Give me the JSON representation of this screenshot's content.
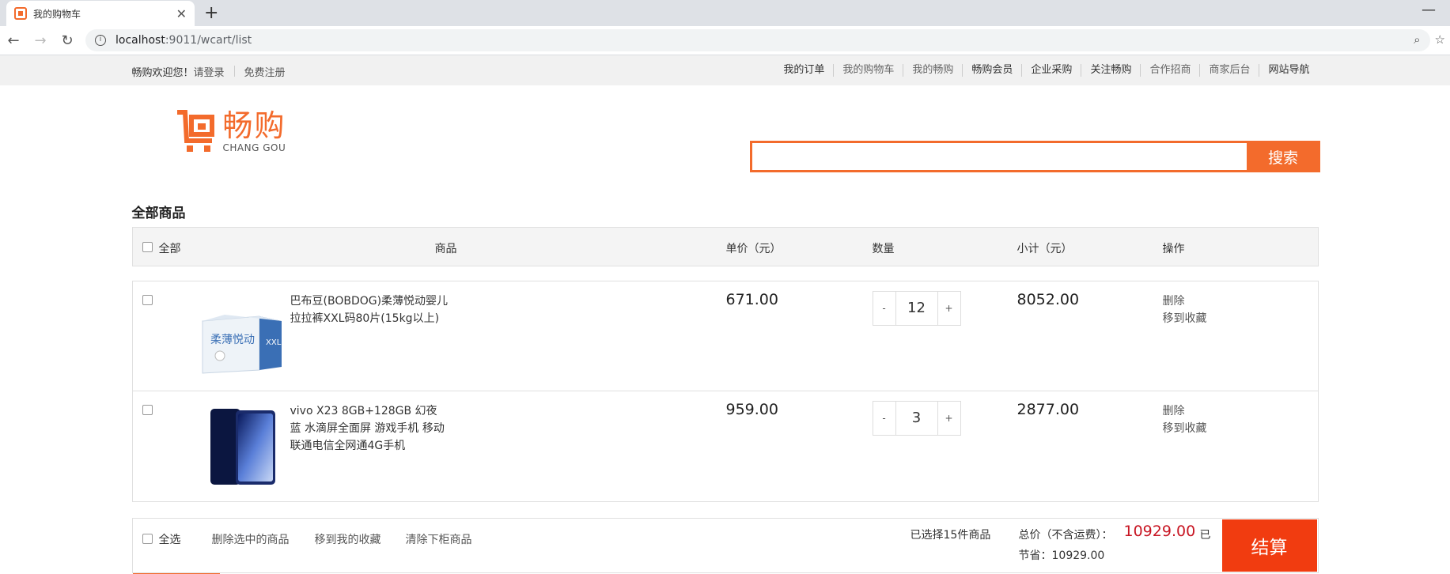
{
  "browser": {
    "tab_title": "我的购物车",
    "url_host": "localhost",
    "url_path": ":9011/wcart/list"
  },
  "topbar": {
    "welcome": "畅购欢迎您！",
    "login": "请登录",
    "register": "免费注册",
    "nav": [
      "我的订单",
      "我的购物车",
      "我的畅购",
      "畅购会员",
      "企业采购",
      "关注畅购",
      "合作招商",
      "商家后台",
      "网站导航"
    ]
  },
  "logo": {
    "cn": "畅购",
    "en": "CHANG GOU"
  },
  "search": {
    "button": "搜索",
    "value": ""
  },
  "cart": {
    "title": "全部商品",
    "headers": {
      "all": "全部",
      "product": "商品",
      "price": "单价（元）",
      "qty": "数量",
      "subtotal": "小计（元）",
      "ops": "操作"
    },
    "items": [
      {
        "name": "巴布豆(BOBDOG)柔薄悦动婴儿拉拉裤XXL码80片(15kg以上)",
        "price": "671.00",
        "qty": "12",
        "subtotal": "8052.00",
        "delete": "删除",
        "favorite": "移到收藏",
        "thumb": "diaper-box"
      },
      {
        "name": "vivo X23 8GB+128GB 幻夜蓝 水滴屏全面屏 游戏手机 移动联通电信全网通4G手机",
        "price": "959.00",
        "qty": "3",
        "subtotal": "2877.00",
        "delete": "删除",
        "favorite": "移到收藏",
        "thumb": "phone"
      }
    ],
    "qty_minus": "-",
    "qty_plus": "+"
  },
  "footer": {
    "select_all": "全选",
    "delete_selected": "删除选中的商品",
    "move_favorites": "移到我的收藏",
    "clear_removed": "清除下柜商品",
    "selected_count": "已选择15件商品",
    "total_label": "总价（不含运费）：",
    "total_value": "10929.00",
    "saved_prefix": "已",
    "saved_label": "节省：10929.00",
    "settle": "结算"
  },
  "colors": {
    "brand": "#f36b2c",
    "settle": "#f13c10",
    "price_red": "#c81623"
  }
}
